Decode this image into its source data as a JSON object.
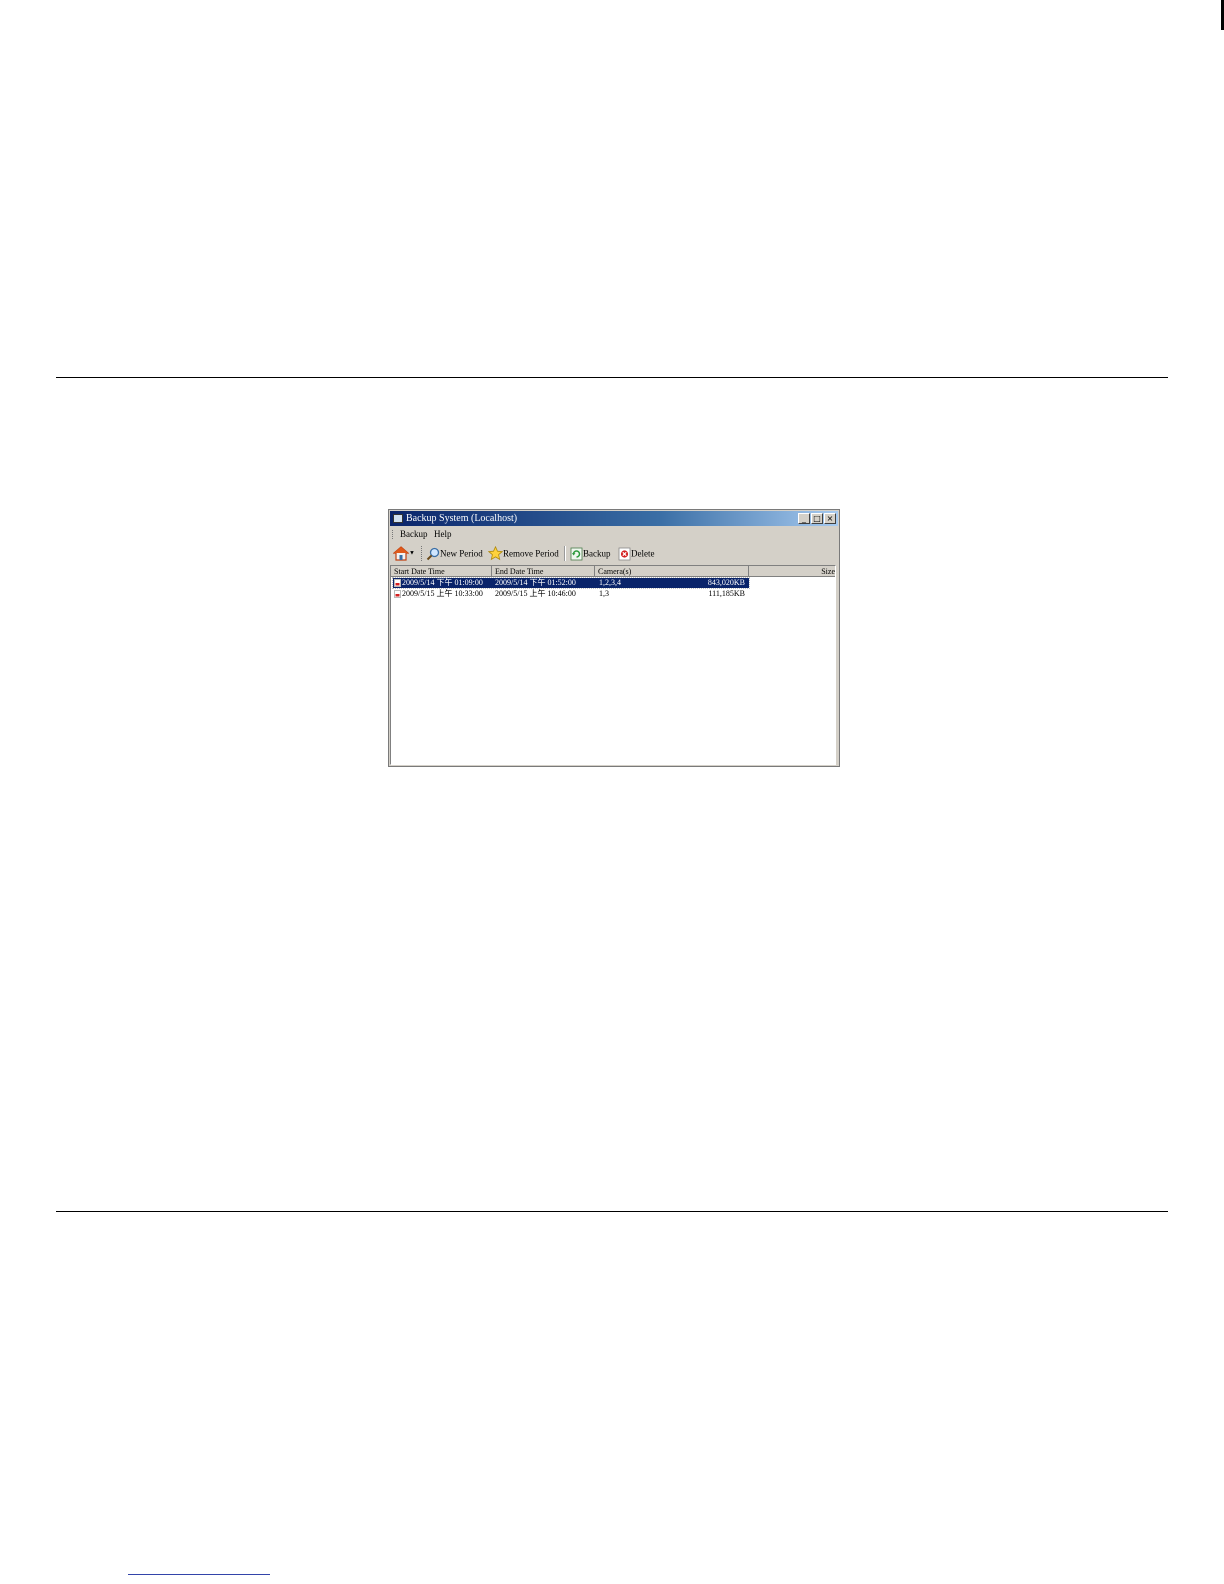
{
  "window": {
    "title": "Backup System (Localhost)",
    "controls": {
      "minimize": "_",
      "maximize": "□",
      "close": "×"
    }
  },
  "menu": {
    "items": [
      "Backup",
      "Help"
    ]
  },
  "toolbar": {
    "new_period": "New Period",
    "remove_period": "Remove Period",
    "backup": "Backup",
    "delete": "Delete"
  },
  "table": {
    "columns": [
      "Start Date Time",
      "End Date Time",
      "Camera(s)",
      "Size"
    ],
    "rows": [
      {
        "start": "2009/5/14 下午 01:09:00",
        "end": "2009/5/14 下午 01:52:00",
        "cameras": "1,2,3,4",
        "size": "843,020KB",
        "selected": true
      },
      {
        "start": "2009/5/15 上午 10:33:00",
        "end": "2009/5/15 上午 10:46:00",
        "cameras": "1,3",
        "size": "111,185KB",
        "selected": false
      }
    ]
  },
  "colors": {
    "title_start": "#0a246a",
    "title_end": "#a6caf0",
    "selection": "#0a246a",
    "chrome": "#d4d0c8"
  }
}
